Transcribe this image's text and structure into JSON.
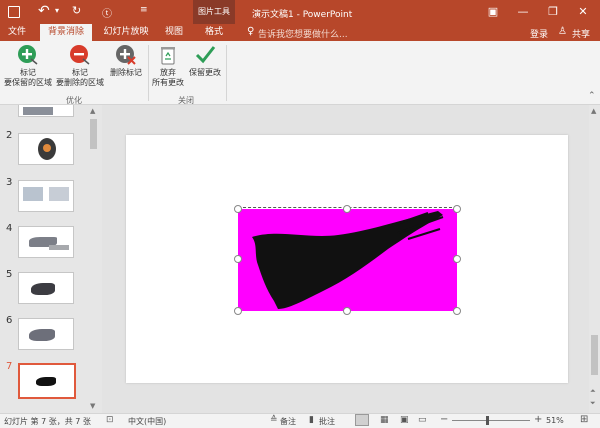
{
  "titlebar": {
    "context_tool": "图片工具",
    "doc_title": "演示文稿1 - PowerPoint",
    "window_buttons": [
      "ribbon-display-icon",
      "minimize-icon",
      "restore-icon",
      "close-icon"
    ]
  },
  "tabs": [
    {
      "label": "文件",
      "active": false
    },
    {
      "label": "背景消除",
      "active": true
    },
    {
      "label": "幻灯片放映",
      "active": false
    },
    {
      "label": "视图",
      "active": false
    },
    {
      "label": "格式",
      "active": false
    }
  ],
  "tellme": "告诉我您想要做什么...",
  "login": "登录",
  "share": "共享",
  "ribbon": {
    "mark_keep": [
      "标记",
      "要保留的区域"
    ],
    "mark_remove": [
      "标记",
      "要删除的区域"
    ],
    "delete_mark": "删除标记",
    "discard": [
      "放弃",
      "所有更改"
    ],
    "keep_changes": "保留更改",
    "group_optimize": "优化",
    "group_close": "关闭"
  },
  "slides": [
    {
      "num": "2"
    },
    {
      "num": "3"
    },
    {
      "num": "4"
    },
    {
      "num": "5"
    },
    {
      "num": "6"
    },
    {
      "num": "7",
      "selected": true
    }
  ],
  "status": {
    "slide_info": "幻灯片 第 7 张，共 7 张",
    "language": "中文(中国)",
    "notes": "备注",
    "comments": "批注",
    "zoom": "51%"
  },
  "colors": {
    "accent": "#b7472a",
    "magenta": "#ff00ff",
    "selected_slide": "#e0593c"
  }
}
